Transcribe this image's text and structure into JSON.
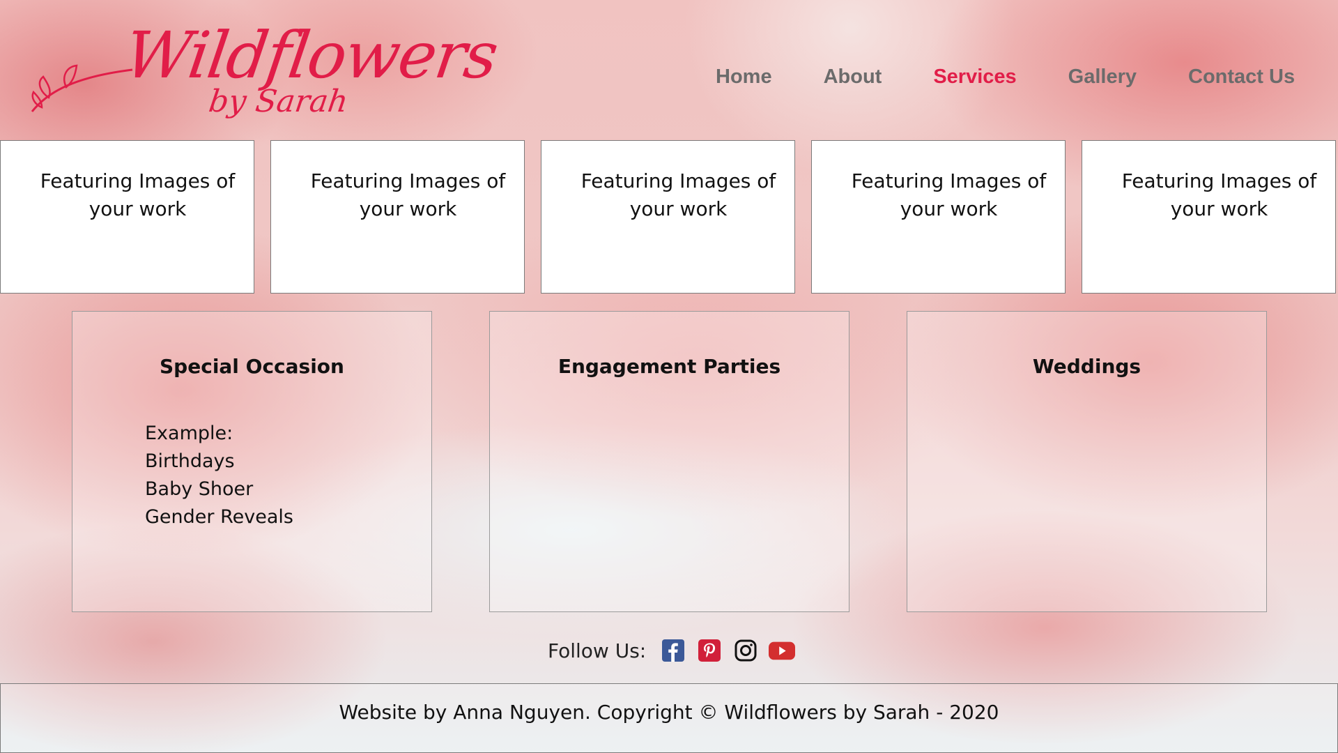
{
  "brand": {
    "name": "Wildflowers",
    "byline": "by Sarah",
    "accent_color": "#e11d48"
  },
  "nav": {
    "items": [
      {
        "label": "Home",
        "active": false
      },
      {
        "label": "About",
        "active": false
      },
      {
        "label": "Services",
        "active": true
      },
      {
        "label": "Gallery",
        "active": false
      },
      {
        "label": "Contact Us",
        "active": false
      }
    ]
  },
  "features": [
    {
      "text": "Featuring Images of your work"
    },
    {
      "text": "Featuring Images of your work"
    },
    {
      "text": "Featuring Images of your work"
    },
    {
      "text": "Featuring Images of your work"
    },
    {
      "text": "Featuring Images of your work"
    }
  ],
  "services": [
    {
      "title": "Special Occasion",
      "lines": [
        "Example:",
        "Birthdays",
        "Baby Shoer",
        "Gender Reveals"
      ]
    },
    {
      "title": "Engagement Parties",
      "lines": []
    },
    {
      "title": "Weddings",
      "lines": []
    }
  ],
  "follow": {
    "label": "Follow Us:",
    "icons": [
      "facebook-icon",
      "pinterest-icon",
      "instagram-icon",
      "youtube-icon"
    ]
  },
  "footer": {
    "text": "Website by Anna Nguyen. Copyright © Wildflowers by Sarah - 2020"
  }
}
